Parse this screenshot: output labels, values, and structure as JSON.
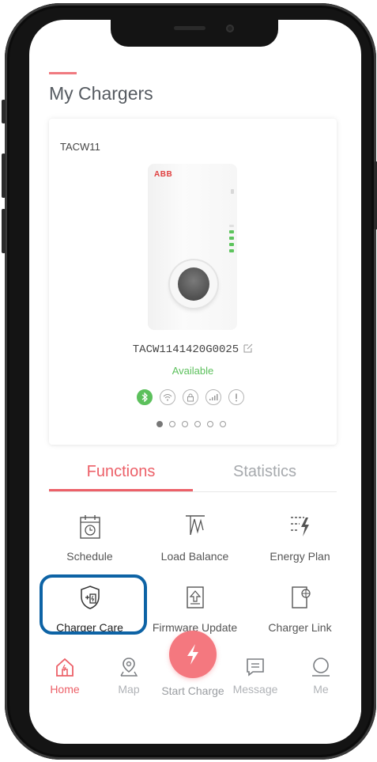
{
  "header": {
    "title": "My Chargers"
  },
  "charger_card": {
    "model": "TACW11",
    "brand_logo": "ABB",
    "serial": "TACW1141420G0025",
    "status": "Available",
    "status_icons": [
      "bluetooth-icon",
      "wifi-icon",
      "lock-icon",
      "cellular-icon",
      "alert-icon"
    ],
    "pager": {
      "count": 6,
      "active_index": 0
    }
  },
  "tabs": [
    {
      "label": "Functions",
      "active": true
    },
    {
      "label": "Statistics",
      "active": false
    }
  ],
  "functions": [
    {
      "label": "Schedule",
      "icon": "calendar-clock-icon"
    },
    {
      "label": "Load Balance",
      "icon": "load-balance-icon"
    },
    {
      "label": "Energy Plan",
      "icon": "energy-plan-icon"
    },
    {
      "label": "Charger Care",
      "icon": "shield-charger-icon",
      "highlighted": true
    },
    {
      "label": "Firmware Update",
      "icon": "firmware-update-icon"
    },
    {
      "label": "Charger Link",
      "icon": "charger-link-icon"
    }
  ],
  "bottom_nav": {
    "items": [
      {
        "label": "Home",
        "icon": "home-icon",
        "active": true
      },
      {
        "label": "Map",
        "icon": "map-pin-icon"
      },
      {
        "label": "Start Charge",
        "icon": "lightning-icon"
      },
      {
        "label": "Message",
        "icon": "message-icon"
      },
      {
        "label": "Me",
        "icon": "profile-icon"
      }
    ]
  },
  "colors": {
    "accent": "#ec6068",
    "status_green": "#5cc05c",
    "highlight_blue": "#0d63a5"
  }
}
